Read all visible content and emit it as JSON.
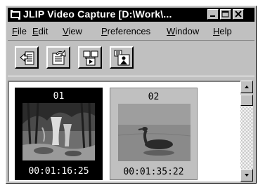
{
  "window": {
    "title": "JLIP Video Capture [D:\\Work\\...",
    "buttons": {
      "minimize": "minimize",
      "maximize": "maximize",
      "close": "close"
    }
  },
  "menubar": {
    "items": [
      {
        "accel": "F",
        "rest": "ile"
      },
      {
        "accel": "E",
        "rest": "dit"
      },
      {
        "accel": "V",
        "rest": "iew"
      },
      {
        "accel": "P",
        "rest": "references"
      },
      {
        "accel": "W",
        "rest": "indow"
      },
      {
        "accel": "H",
        "rest": "elp"
      }
    ]
  },
  "toolbar": {
    "buttons": [
      {
        "icon": "import-clip-icon"
      },
      {
        "icon": "refresh-capture-icon"
      },
      {
        "icon": "sequence-play-icon"
      },
      {
        "icon": "camera-person-icon"
      }
    ]
  },
  "thumbnails": [
    {
      "number": "01",
      "timecode": "00:01:16:25",
      "selected": true,
      "scene": "waterfall-forest"
    },
    {
      "number": "02",
      "timecode": "00:01:35:22",
      "selected": false,
      "scene": "duck-on-water"
    }
  ],
  "colors": {
    "titlebar": "#000000",
    "face": "#c0c0c0",
    "selected": "#000000"
  }
}
